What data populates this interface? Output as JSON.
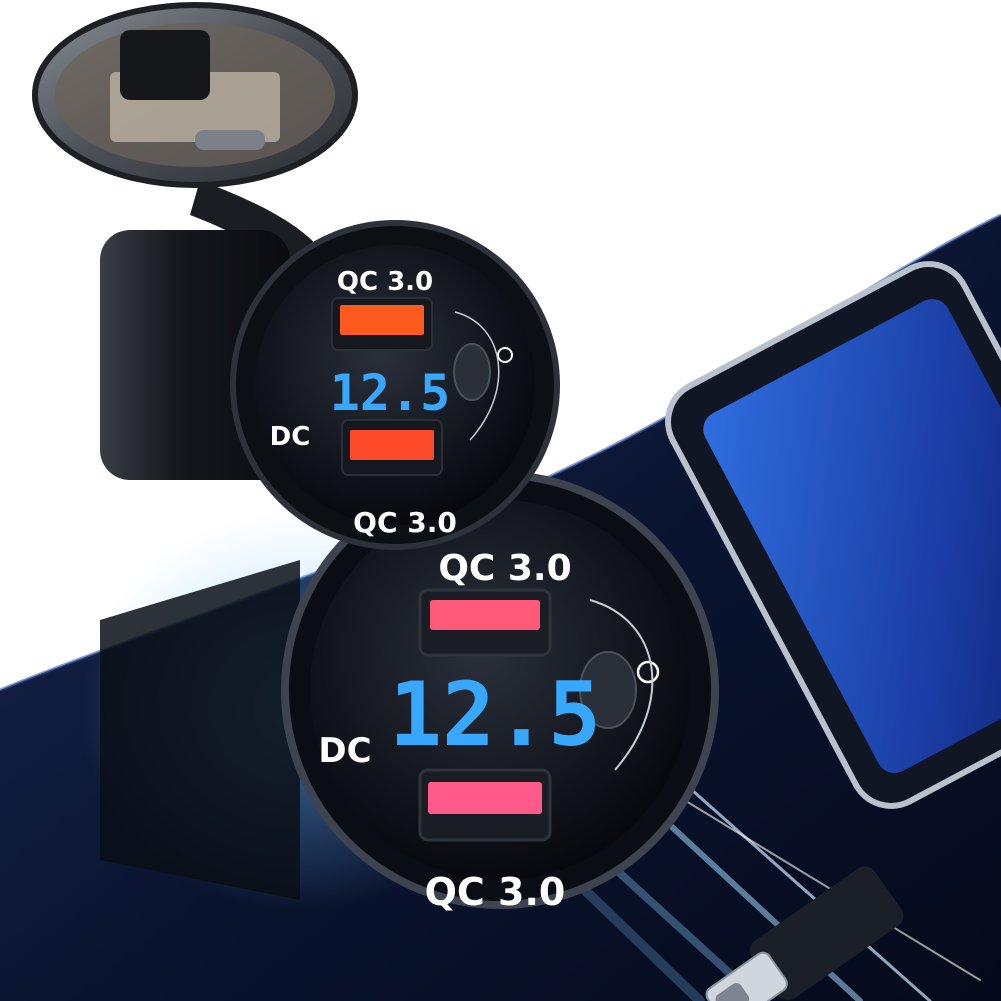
{
  "product": {
    "top_label": "QC 3.0",
    "bottom_label": "QC 3.0",
    "side_label": "DC",
    "voltage_display": "12.5"
  },
  "closeup": {
    "top_label": "QC 3.0",
    "bottom_label": "QC 3.0",
    "side_label": "DC",
    "voltage_display": "12.5"
  },
  "icons": {
    "power": "power-icon",
    "usb": "usb-port-icon"
  },
  "colors": {
    "background_dark": "#0d1a33",
    "display_blue": "#38a8ff",
    "port_orange": "#ff5a1e",
    "port_pink": "#ff5a8a",
    "light_streak": "#9fd8ff"
  }
}
